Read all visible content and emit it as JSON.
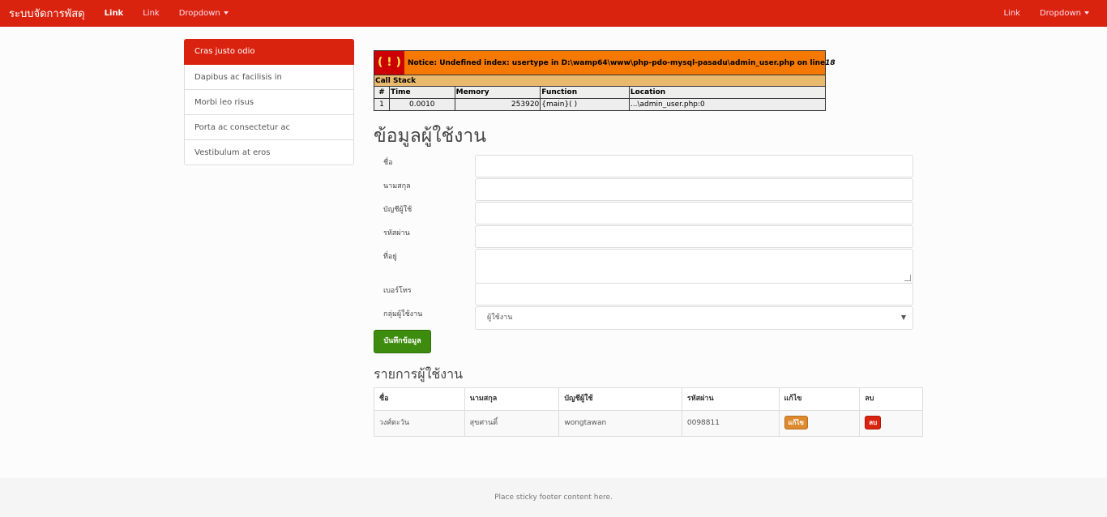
{
  "navbar": {
    "brand": "ระบบจัดการพัสดุ",
    "left_links": [
      "Link",
      "Link"
    ],
    "left_dropdown": "Dropdown",
    "right_link": "Link",
    "right_dropdown": "Dropdown"
  },
  "sidebar": {
    "items": [
      {
        "label": "Cras justo odio",
        "active": true
      },
      {
        "label": "Dapibus ac facilisis in"
      },
      {
        "label": "Morbi leo risus"
      },
      {
        "label": "Porta ac consectetur ac"
      },
      {
        "label": "Vestibulum at eros"
      }
    ]
  },
  "notice": {
    "bang": "( ! )",
    "message": "Notice: Undefined index: usertype in D:\\wamp64\\www\\php-pdo-mysql-pasadu\\admin_user.php on line ",
    "line": "18",
    "call_stack_label": "Call Stack",
    "columns": [
      "#",
      "Time",
      "Memory",
      "Function",
      "Location"
    ],
    "row": [
      "1",
      "0.0010",
      "253920",
      "{main}( )",
      "...\\admin_user.php:0"
    ]
  },
  "form": {
    "title": "ข้อมูลผู้ใช้งาน",
    "labels": {
      "first_name": "ชื่อ",
      "last_name": "นามสกุล",
      "username": "บัญชีผู้ใช้",
      "password": "รหัสผ่าน",
      "address": "ที่อยู่",
      "phone": "เบอร์โทร",
      "group": "กลุ่มผู้ใช้งาน"
    },
    "group_selected": "ผู้ใช้งาน",
    "save_label": "บันทึกข้อมูล"
  },
  "table": {
    "title": "รายการผู้ใช้งาน",
    "headers": [
      "ชื่อ",
      "นามสกุล",
      "บัญชีผู้ใช้",
      "รหัสผ่าน",
      "แก้ไข",
      "ลบ"
    ],
    "rows": [
      {
        "first_name": "วงศ์ตะวัน",
        "last_name": "สุขศานติ์",
        "username": "wongtawan",
        "password": "0098811",
        "edit_label": "แก้ไข",
        "delete_label": "ลบ"
      }
    ]
  },
  "footer": {
    "text": "Place sticky footer content here."
  },
  "colors": {
    "brand": "#d9230f",
    "success": "#3d8c0d",
    "warning": "#dd8a2f"
  }
}
